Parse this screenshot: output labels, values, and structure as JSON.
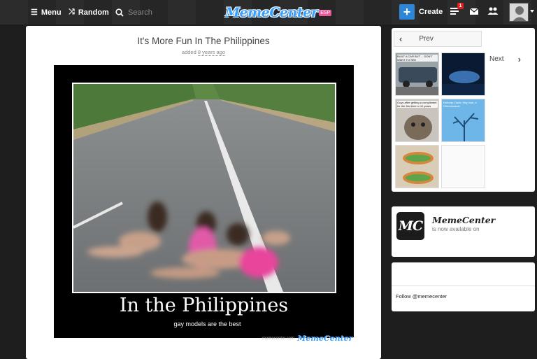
{
  "nav": {
    "menu_label": "Menu",
    "random_label": "Random",
    "search_placeholder": "Search",
    "logo_text": "MemeCenter",
    "logo_badge": "ESP",
    "create_label": "Create",
    "notification_count": "1"
  },
  "post": {
    "title": "It's More Fun In The Philippines",
    "added_prefix": "added",
    "added_when": "8 years ago",
    "meme_caption": "In the Philippines",
    "meme_subcaption": "gay models are the  best",
    "watermark_site": "memecenter.com",
    "watermark_logo": "MemeCenter"
  },
  "sidebar": {
    "prev_label": "Prev",
    "next_label": "Next",
    "thumbs": [
      {
        "text": "BUILT A CAR BUT ... DON'T WANT TO SEE"
      },
      {
        "text": ""
      },
      {
        "text": "Guys after getting a compliment for the first time in 10 years"
      },
      {
        "text": "Nobody: Dads: Hey look, a Chemmosser"
      },
      {
        "text": ""
      },
      {
        "text": ""
      }
    ],
    "promo_name": "MemeCenter",
    "promo_sub": "is now available on",
    "promo_logo": "MC",
    "follow_text": "Follow @memecenter"
  },
  "colors": {
    "accent": "#2f86d6",
    "background": "#1e1e1e",
    "badge": "#e02020"
  }
}
